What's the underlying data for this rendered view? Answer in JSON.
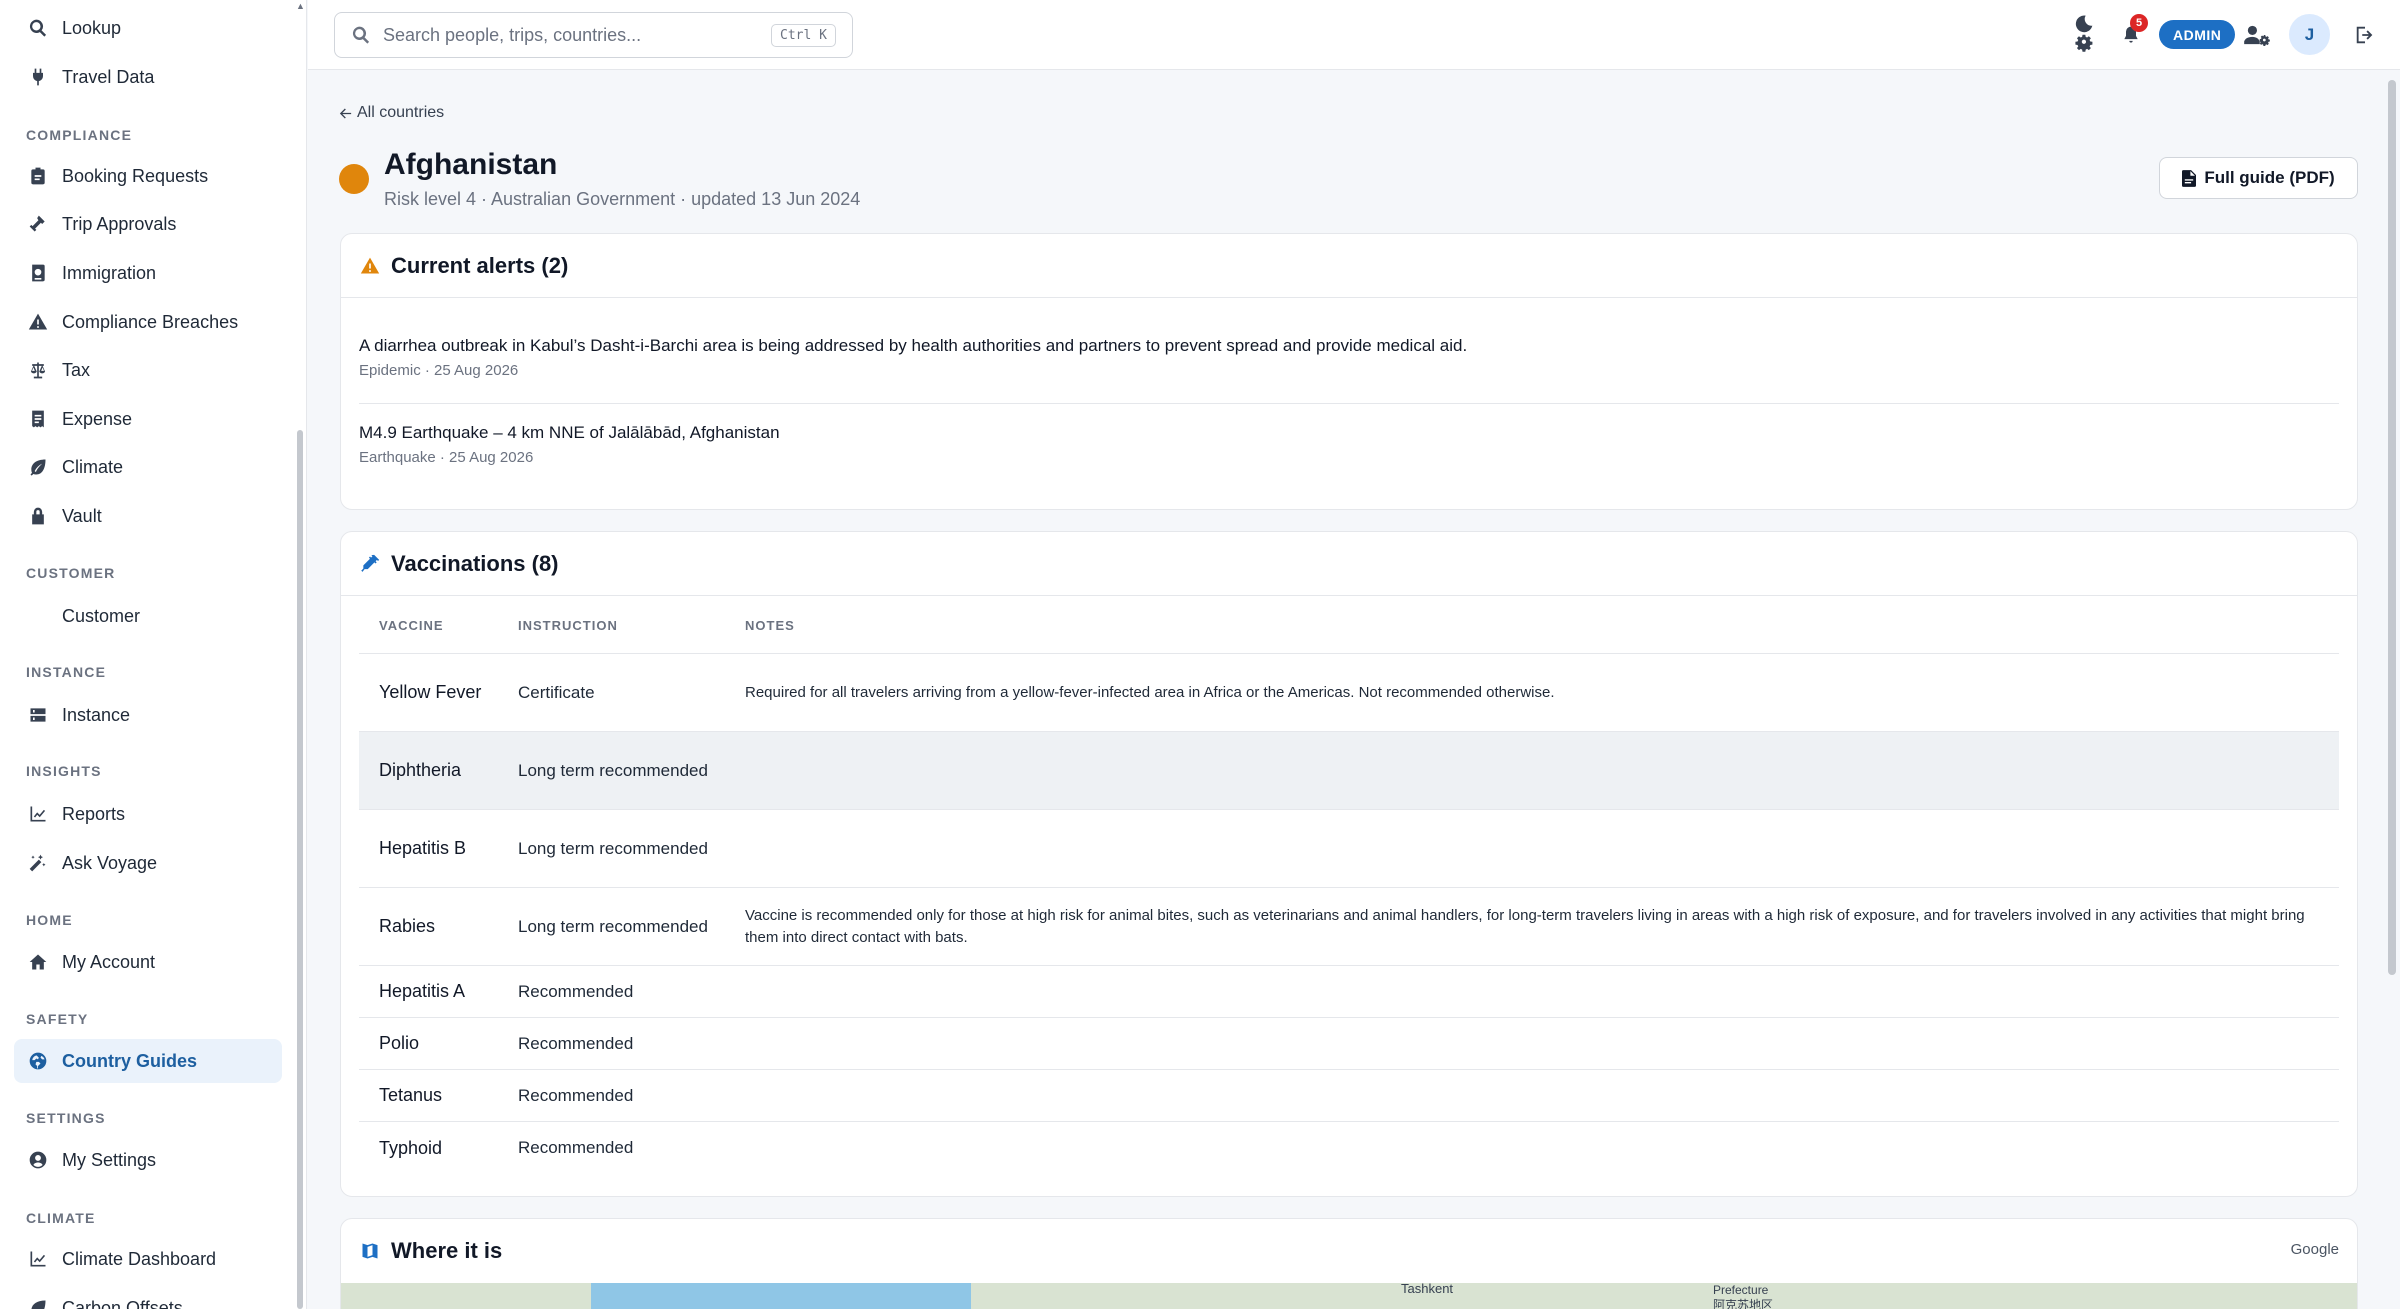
{
  "sidebar": {
    "items_top": [
      {
        "label": "Lookup",
        "icon": "search-icon"
      },
      {
        "label": "Travel Data",
        "icon": "plug-icon"
      }
    ],
    "compliance": {
      "heading": "COMPLIANCE",
      "items": [
        {
          "label": "Booking Requests",
          "icon": "clipboard-icon"
        },
        {
          "label": "Trip Approvals",
          "icon": "gavel-icon"
        },
        {
          "label": "Immigration",
          "icon": "passport-icon"
        },
        {
          "label": "Compliance Breaches",
          "icon": "warning-icon"
        },
        {
          "label": "Tax",
          "icon": "scale-icon"
        },
        {
          "label": "Expense",
          "icon": "receipt-icon"
        },
        {
          "label": "Climate",
          "icon": "leaf-icon"
        },
        {
          "label": "Vault",
          "icon": "lock-icon"
        }
      ]
    },
    "customer": {
      "heading": "CUSTOMER",
      "items": [
        {
          "label": "Customer"
        }
      ]
    },
    "instance": {
      "heading": "INSTANCE",
      "items": [
        {
          "label": "Instance",
          "icon": "server-icon"
        }
      ]
    },
    "insights": {
      "heading": "INSIGHTS",
      "items": [
        {
          "label": "Reports",
          "icon": "chart-line-icon"
        },
        {
          "label": "Ask Voyage",
          "icon": "magic-wand-icon"
        }
      ]
    },
    "home": {
      "heading": "HOME",
      "items": [
        {
          "label": "My Account",
          "icon": "house-icon"
        }
      ]
    },
    "safety": {
      "heading": "SAFETY",
      "items": [
        {
          "label": "Country Guides",
          "icon": "globe-icon"
        }
      ]
    },
    "settings": {
      "heading": "SETTINGS",
      "items": [
        {
          "label": "My Settings",
          "icon": "user-circle-icon"
        }
      ]
    },
    "climate": {
      "heading": "CLIMATE",
      "items": [
        {
          "label": "Climate Dashboard",
          "icon": "chart-line-icon"
        },
        {
          "label": "Carbon Offsets"
        }
      ]
    }
  },
  "topbar": {
    "search_placeholder": "Search people, trips, countries...",
    "search_shortcut": "Ctrl K",
    "notification_count": "5",
    "role_badge": "ADMIN",
    "avatar_initial": "J"
  },
  "page": {
    "back_link": "All countries",
    "country": "Afghanistan",
    "subtitle": "Risk level 4 · Australian Government · updated 13 Jun 2024",
    "risk_color": "#e0860c",
    "pdf_button": "Full guide (PDF)"
  },
  "alerts": {
    "title": "Current alerts (2)",
    "items": [
      {
        "title": "A diarrhea outbreak in Kabul’s Dasht-i-Barchi area is being addressed by health authorities and partners to prevent spread and provide medical aid.",
        "meta": "Epidemic · 25 Aug 2026"
      },
      {
        "title": "M4.9 Earthquake – 4 km NNE of Jalālābād, Afghanistan",
        "meta": "Earthquake · 25 Aug 2026"
      }
    ]
  },
  "vaccinations": {
    "title": "Vaccinations (8)",
    "columns": [
      "VACCINE",
      "INSTRUCTION",
      "NOTES"
    ],
    "rows": [
      {
        "vaccine": "Yellow Fever",
        "instruction": "Certificate",
        "notes": "Required for all travelers arriving from a yellow-fever-infected area in Africa or the Americas. Not recommended otherwise."
      },
      {
        "vaccine": "Diphtheria",
        "instruction": "Long term recommended",
        "notes": ""
      },
      {
        "vaccine": "Hepatitis B",
        "instruction": "Long term recommended",
        "notes": ""
      },
      {
        "vaccine": "Rabies",
        "instruction": "Long term recommended",
        "notes": "Vaccine is recommended only for those at high risk for animal bites, such as veterinarians and animal handlers, for long-term travelers living in areas with a high risk of exposure, and for travelers involved in any activities that might bring them into direct contact with bats."
      },
      {
        "vaccine": "Hepatitis A",
        "instruction": "Recommended",
        "notes": ""
      },
      {
        "vaccine": "Polio",
        "instruction": "Recommended",
        "notes": ""
      },
      {
        "vaccine": "Tetanus",
        "instruction": "Recommended",
        "notes": ""
      },
      {
        "vaccine": "Typhoid",
        "instruction": "Recommended",
        "notes": ""
      }
    ]
  },
  "map": {
    "title": "Where it is",
    "provider": "Google",
    "labels": [
      "Tashkent",
      "Prefecture",
      "阿克苏地区"
    ]
  }
}
